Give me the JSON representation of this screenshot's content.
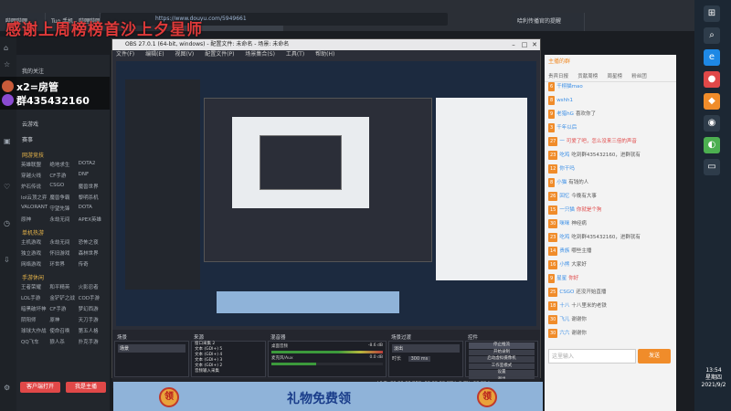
{
  "overlay_title": "感谢上周榜榜首沙上夕星师",
  "browser": {
    "tabs": [
      "哔哩哔哩",
      "Tuo 手机 - 哔哩哔哩",
      "武汉斗鱼网络科技有限公司",
      "六六精灵练什么直播_永劫无间直播",
      "哈利传播官的提醒"
    ],
    "address": "https://www.douyu.com/5949661"
  },
  "admin_card": {
    "line1": "x2=房管",
    "line2": "群435432160"
  },
  "left_sidebar": {
    "top_items": [
      "我的关注",
      "云游戏",
      "赛事"
    ],
    "sections": [
      {
        "title": "网游竞技",
        "items": [
          "英雄联盟",
          "绝地求生",
          "DOTA2",
          "穿越火线",
          "CF手游",
          "DNF",
          "炉石传说",
          "CSGO",
          "魔兽世界",
          "lol云顶之弈",
          "魔兽争霸",
          "黎明杀机",
          "VALORANT",
          "守望先锋",
          "DOTA",
          "原神",
          "永劫无间",
          "APEX英雄"
        ]
      },
      {
        "title": "单机热游",
        "items": [
          "主机游戏",
          "永劫无间",
          "恐怖之夜",
          "独立游戏",
          "怀旧游戏",
          "森林世界",
          "网络游戏",
          "环世界",
          "传奇"
        ]
      },
      {
        "title": "手游休闲",
        "items": [
          "王者荣耀",
          "和平精英",
          "火影忍者",
          "LOL手游",
          "金铲铲之战",
          "COD手游",
          "暗黑破坏神",
          "CF手游",
          "梦幻西游",
          "阴阳师",
          "原神",
          "天刀手游",
          "球球大作战",
          "使命召唤",
          "第五人格",
          "QQ飞车",
          "狼人杀",
          "扑克手游"
        ]
      }
    ],
    "bottom_buttons": [
      "客户端打开",
      "我是主播"
    ]
  },
  "obs": {
    "title": "OBS 27.0.1 (64-bit, windows) - 配置文件: 未命名 - 场景: 未命名",
    "menu": [
      "文件(F)",
      "编辑(E)",
      "视图(V)",
      "配置文件(P)",
      "场景集合(S)",
      "工具(T)",
      "帮助(H)"
    ],
    "panels": {
      "scenes": "场景",
      "sources": "来源",
      "mixer": "混音器",
      "transitions": "场景过渡",
      "controls": "控件"
    },
    "scene_items": [
      "场景"
    ],
    "source_items": [
      "窗口采集 2",
      "文本 (GDI+) 5",
      "文本 (GDI+) 4",
      "文本 (GDI+) 3",
      "文本 (GDI+) 2",
      "音频输入采集"
    ],
    "mixer_channels": [
      "桌面音频",
      "麦克风/Aux"
    ],
    "mixer_levels": [
      "-8.6 dB",
      "0.0 dB"
    ],
    "transition": "淡出",
    "transition_duration_label": "时长",
    "transition_duration": "300 ms",
    "control_buttons": [
      "停止推流",
      "开始录制",
      "启动虚拟摄像机",
      "工作室模式",
      "设置",
      "退出"
    ],
    "status": "LIVE: 00:00:00   REC: 00:00:00   CPU: 0.7%, 60.00 fps"
  },
  "right_panel": {
    "tabs": [
      "贵宾日报",
      "贡献周榜",
      "周星榜",
      "粉丝团"
    ],
    "streamer_notice": "主播的群",
    "chat": [
      {
        "level": "6",
        "nick": "千栩猫mao",
        "msg": ""
      },
      {
        "level": "8",
        "nick": "wshh1",
        "msg": ""
      },
      {
        "level": "9",
        "nick": "老猎hG",
        "msg": "喜欢你了"
      },
      {
        "level": "3",
        "nick": "千年以后",
        "msg": ""
      },
      {
        "level": "27",
        "nick": "一",
        "msg": "可爱了吧，怎么没来三倍的声音"
      },
      {
        "level": "23",
        "nick": "吃鸡",
        "msg": "吃到群435432160，进群就有"
      },
      {
        "level": "12",
        "nick": "你干吗",
        "msg": ""
      },
      {
        "level": "8",
        "nick": "小猫",
        "msg": "有钱的人"
      },
      {
        "level": "26",
        "nick": "回忆",
        "msg": "今晚有大事"
      },
      {
        "level": "15",
        "nick": "一只猫",
        "msg": "你就是个狗"
      },
      {
        "level": "30",
        "nick": "咪咪",
        "msg": "神经病"
      },
      {
        "level": "23",
        "nick": "吃鸡",
        "msg": "吃到群435432160，进群就有"
      },
      {
        "level": "14",
        "nick": "贵族",
        "msg": "哪些主播"
      },
      {
        "level": "16",
        "nick": "小熊",
        "msg": "大家好"
      },
      {
        "level": "9",
        "nick": "星星",
        "msg": "你好"
      },
      {
        "level": "25",
        "nick": "CSGO",
        "msg": "还没开始直播"
      },
      {
        "level": "18",
        "nick": "十八",
        "msg": "十八里米的老铁"
      },
      {
        "level": "30",
        "nick": "飞儿",
        "msg": "谢谢你"
      },
      {
        "level": "30",
        "nick": "六六",
        "msg": "谢谢你"
      }
    ],
    "input_placeholder": "这里输入",
    "send_button": "发送"
  },
  "taskbar": {
    "time": "13:54",
    "weekday": "星期四",
    "date": "2021/9/2"
  },
  "banner": {
    "left_badge": "领",
    "text": "礼物免费领",
    "right_badge": "领"
  },
  "colors": {
    "accent_orange": "#f08c2a",
    "obs_bg": "#2b2e38",
    "overlay_red": "#e03a3a"
  }
}
